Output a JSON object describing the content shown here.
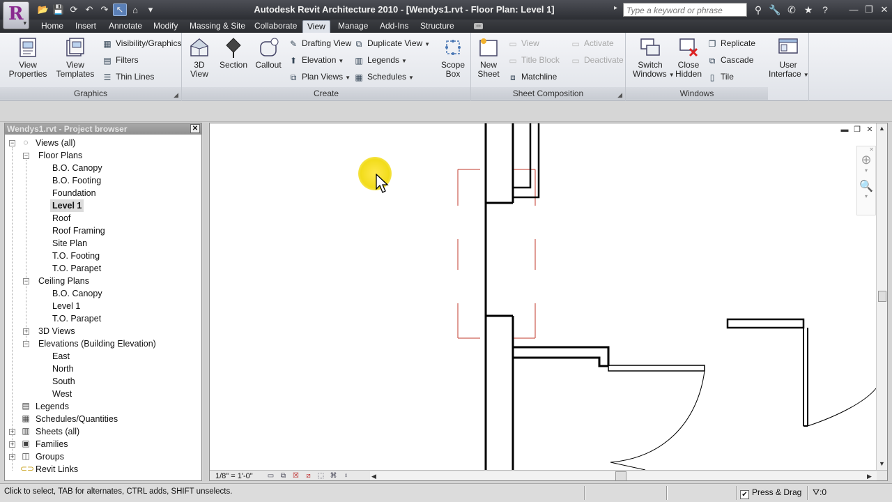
{
  "window": {
    "title": "Autodesk Revit Architecture 2010 - [Wendys1.rvt - Floor Plan: Level 1]",
    "search_placeholder": "Type a keyword or phrase",
    "app_letter": "R"
  },
  "tabs": [
    "Home",
    "Insert",
    "Annotate",
    "Modify",
    "Massing & Site",
    "Collaborate",
    "View",
    "Manage",
    "Add-Ins",
    "Structure"
  ],
  "active_tab": "View",
  "ribbon": {
    "graphics": {
      "title": "Graphics",
      "view_properties": "View\nProperties",
      "view_templates": "View\nTemplates",
      "visibility_graphics": "Visibility/Graphics",
      "filters": "Filters",
      "thin_lines": "Thin Lines"
    },
    "create": {
      "title": "Create",
      "view_3d": "3D\nView",
      "section": "Section",
      "callout": "Callout",
      "drafting_view": "Drafting View",
      "elevation": "Elevation",
      "plan_views": "Plan Views",
      "duplicate_view": "Duplicate View",
      "legends": "Legends",
      "schedules": "Schedules",
      "scope_box": "Scope\nBox"
    },
    "sheet_composition": {
      "title": "Sheet Composition",
      "new_sheet": "New\nSheet",
      "view": "View",
      "title_block": "Title Block",
      "matchline": "Matchline",
      "activate": "Activate",
      "deactivate": "Deactivate"
    },
    "windows": {
      "title": "Windows",
      "switch_windows": "Switch\nWindows",
      "close_hidden": "Close\nHidden",
      "replicate": "Replicate",
      "cascade": "Cascade",
      "tile": "Tile"
    },
    "user_interface": "User\nInterface"
  },
  "browser": {
    "title": "Wendys1.rvt - Project browser",
    "views_all": "Views (all)",
    "floor_plans": "Floor Plans",
    "floor_plan_items": [
      "B.O. Canopy",
      "B.O. Footing",
      "Foundation",
      "Level 1",
      "Roof",
      "Roof Framing",
      "Site Plan",
      "T.O. Footing",
      "T.O. Parapet"
    ],
    "selected_item": "Level 1",
    "ceiling_plans": "Ceiling Plans",
    "ceiling_plan_items": [
      "B.O. Canopy",
      "Level 1",
      "T.O. Parapet"
    ],
    "views_3d": "3D Views",
    "elevations": "Elevations (Building Elevation)",
    "elevation_items": [
      "East",
      "North",
      "South",
      "West"
    ],
    "legends": "Legends",
    "schedules": "Schedules/Quantities",
    "sheets": "Sheets (all)",
    "families": "Families",
    "groups": "Groups",
    "revit_links": "Revit Links"
  },
  "viewbar": {
    "scale": "1/8\" = 1'-0\""
  },
  "status": {
    "hint": "Click to select, TAB for alternates, CTRL adds, SHIFT unselects.",
    "press_drag": "Press & Drag",
    "press_drag_checked": true,
    "filter_count": ":0"
  },
  "colors": {
    "title_bar": "#2c2e33",
    "ribbon_bg": "#e8eaee",
    "callout_boundary": "#c0392b",
    "wall_line": "#000000",
    "cursor_highlight": "#f5e020"
  }
}
